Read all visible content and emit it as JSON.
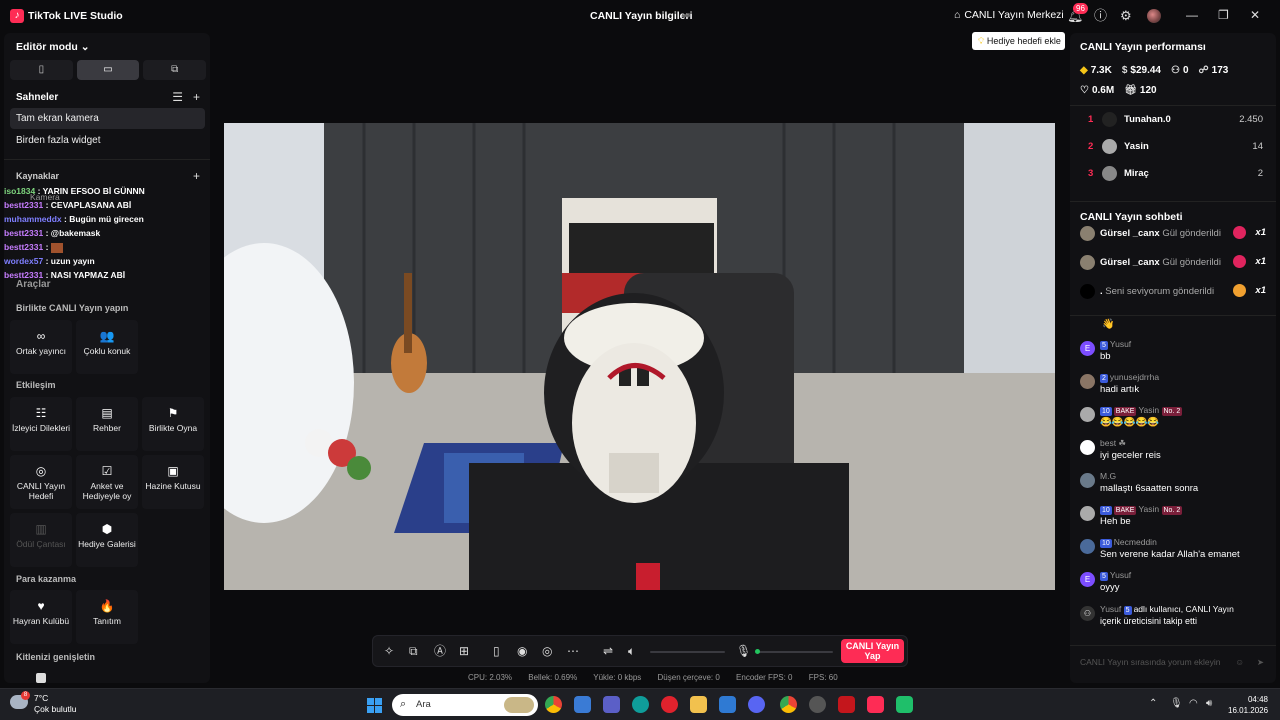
{
  "app": {
    "title": "TikTok LIVE Studio",
    "live_info": "CANLI Yayın bilgileri",
    "live_center": "CANLI Yayın Merkezi",
    "notification_count": "96",
    "accent": "#fe2c55"
  },
  "left": {
    "editor_mode": "Editör modu",
    "layout_tabs": [
      "▯",
      "▭",
      "⧉"
    ],
    "scenes_title": "Sahneler",
    "scenes": [
      "Tam ekran kamera",
      "Birden fazla widget"
    ],
    "sources_title": "Kaynaklar",
    "overlay_partial": "Kamera",
    "chat_overlay": [
      {
        "user": "iso1834",
        "text": ": YARIN EFSOO Bİ GÜNNN"
      },
      {
        "user": "bestt2331",
        "text": ": CEVAPLASANA ABİ"
      },
      {
        "user": "muhammeddx",
        "text": ": Bugün mü girecen"
      },
      {
        "user": "bestt2331",
        "text": ": @bakemask"
      },
      {
        "user": "bestt2331",
        "text": ":"
      },
      {
        "user": "wordex57",
        "text": ": uzun yayın"
      },
      {
        "user": "bestt2331",
        "text": ": NASI YAPMAZ ABİ"
      }
    ],
    "tools_title": "Araçlar",
    "group_live_together": "Birlikte CANLI Yayın yapın",
    "group_interaction": "Etkileşim",
    "group_earn": "Para kazanma",
    "group_expand": "Kitlenizi genişletin",
    "tools_live_together": [
      {
        "label": "Ortak yayıncı",
        "icon": "∞"
      },
      {
        "label": "Çoklu konuk",
        "icon": "👥"
      }
    ],
    "tools_interaction": [
      {
        "label": "İzleyici Dilekleri",
        "icon": "☷"
      },
      {
        "label": "Rehber",
        "icon": "▤"
      },
      {
        "label": "Birlikte Oyna",
        "icon": "⚑"
      },
      {
        "label": "CANLI Yayın Hedefi",
        "icon": "◎"
      },
      {
        "label": "Anket ve Hediyeyle oy",
        "icon": "☑"
      },
      {
        "label": "Hazine Kutusu",
        "icon": "▣"
      },
      {
        "label": "Ödül Çantası",
        "icon": "▥"
      },
      {
        "label": "Hediye Galerisi",
        "icon": "⬢"
      }
    ],
    "tools_earn": [
      {
        "label": "Hayran Kulübü",
        "icon": "♥"
      },
      {
        "label": "Tanıtım",
        "icon": "🔥"
      }
    ]
  },
  "stage": {
    "gift_goal_button": "Hediye hedefi ekle",
    "go_live": "CANLI Yayın Yap",
    "stats": {
      "cpu": "CPU: 2.03%",
      "memory": "Bellek: 0.69%",
      "load": "Yükle: 0 kbps",
      "dropped": "Düşen çerçeve: 0",
      "encoder_fps": "Encoder FPS: 0",
      "fps": "FPS: 60"
    }
  },
  "right": {
    "perf_title": "CANLI Yayın performansı",
    "perf": {
      "diamonds": "7.3K",
      "earnings": "$29.44",
      "followers": "0",
      "viewers": "173",
      "likes": "0.6M",
      "gifts": "120"
    },
    "ranking": [
      {
        "rank": "1",
        "name": "Tunahan.0",
        "score": "2.450"
      },
      {
        "rank": "2",
        "name": "Yasin",
        "score": "14"
      },
      {
        "rank": "3",
        "name": "Miraç",
        "score": "2"
      }
    ],
    "chat_title": "CANLI Yayın sohbeti",
    "gifts": [
      {
        "name": "Gürsel _canx",
        "text": "Gül gönderildi",
        "count": "x1"
      },
      {
        "name": "Gürsel _canx",
        "text": "Gül gönderildi",
        "count": "x1"
      },
      {
        "name": ".",
        "text": "Seni seviyorum gönderildi",
        "count": "x1"
      }
    ],
    "first_emoji": "👋",
    "messages": [
      {
        "avatar": "E",
        "level": "5",
        "tag": "",
        "rank": "",
        "user": "Yusuf",
        "text": "bb"
      },
      {
        "avatar": "",
        "level": "2",
        "tag": "",
        "rank": "",
        "user": "yunusejdrrha",
        "text": "hadi artık"
      },
      {
        "avatar": "",
        "level": "10",
        "tag": "BAKE",
        "rank": "No. 2",
        "user": "Yasin",
        "text": "😂😂😂😂😂"
      },
      {
        "avatar": "",
        "level": "",
        "tag": "",
        "rank": "",
        "user": "best ☘",
        "text": "iyi geceler reis"
      },
      {
        "avatar": "",
        "level": "",
        "tag": "",
        "rank": "",
        "user": "M.G",
        "text": "mallaştı 6saatten sonra"
      },
      {
        "avatar": "",
        "level": "10",
        "tag": "BAKE",
        "rank": "No. 2",
        "user": "Yasin",
        "text": "Heh be"
      },
      {
        "avatar": "",
        "level": "10",
        "tag": "",
        "rank": "",
        "user": "Necmeddin",
        "text": "Sen verene kadar Allah'a emanet"
      },
      {
        "avatar": "E",
        "level": "5",
        "tag": "",
        "rank": "",
        "user": "Yusuf",
        "text": "oyyy"
      }
    ],
    "follow_notice": {
      "user": "Yusuf",
      "level": "5",
      "line1": "adlı kullanıcı, CANLI Yayın",
      "line2": "içerik üreticisini takip etti"
    },
    "chat_placeholder": "CANLI Yayın sırasında yorum ekleyin"
  },
  "taskbar": {
    "temperature": "7°C",
    "condition": "Çok bulutlu",
    "weather_badge": "8",
    "search_placeholder": "Ara",
    "time": "04:48",
    "date": "16.01.2026"
  }
}
